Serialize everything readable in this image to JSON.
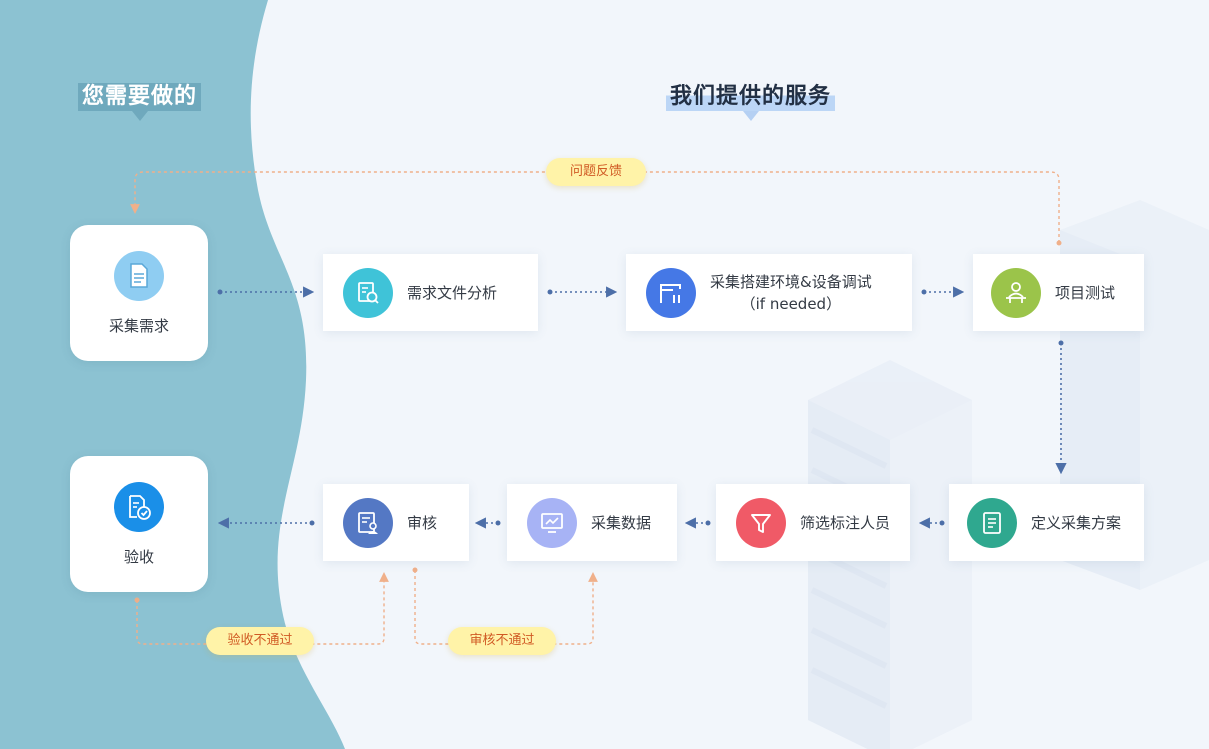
{
  "titles": {
    "left": "您需要做的",
    "right": "我们提供的服务"
  },
  "steps": {
    "collect_requirements": "采集需求",
    "acceptance": "验收",
    "requirement_analysis": "需求文件分析",
    "env_setup_line1": "采集搭建环境&设备调试",
    "env_setup_line2": "（if needed）",
    "project_test": "项目测试",
    "define_plan": "定义采集方案",
    "screen_annotators": "筛选标注人员",
    "collect_data": "采集数据",
    "review": "审核"
  },
  "feedback": {
    "issue_feedback": "问题反馈",
    "acceptance_failed": "验收不通过",
    "review_failed": "审核不通过"
  },
  "colors": {
    "left_panel": "#8cc2d2",
    "background": "#f2f6fb",
    "flow_arrow": "#4d6fa8",
    "feedback_arrow": "#f0b08a",
    "icon_document": "#8fcdf2",
    "icon_acceptance": "#1a8fe8",
    "icon_analysis": "#3fc3d8",
    "icon_env": "#4578e6",
    "icon_test": "#9bc44a",
    "icon_plan": "#2fa88f",
    "icon_screen": "#f05a67",
    "icon_collect": "#a7b3f5",
    "icon_review": "#5478c4"
  },
  "icons": {
    "collect_requirements": "document-icon",
    "acceptance": "approved-document-icon",
    "requirement_analysis": "document-search-icon",
    "env_setup": "window-bars-icon",
    "project_test": "tester-desk-icon",
    "define_plan": "notebook-icon",
    "screen_annotators": "filter-icon",
    "collect_data": "monitor-chart-icon",
    "review": "review-user-icon"
  }
}
